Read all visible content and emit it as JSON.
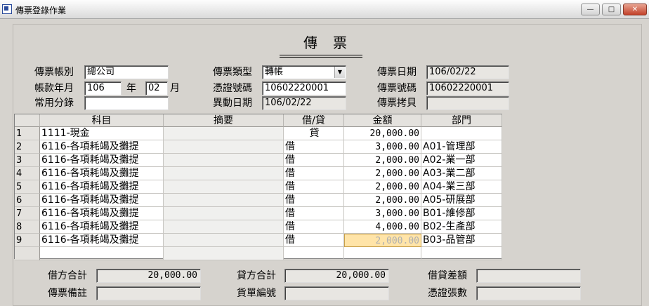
{
  "window": {
    "title": "傳票登錄作業",
    "min": "—",
    "max": "□",
    "close": "✕"
  },
  "header": {
    "title": "傳票",
    "account_label": "傳票帳別",
    "account_value": "總公司",
    "period_label": "帳款年月",
    "year_value": "106",
    "year_unit": "年",
    "month_value": "02",
    "month_unit": "月",
    "common_label": "常用分錄",
    "common_value": "",
    "type_label": "傳票類型",
    "type_value": "轉帳",
    "voucher_no_label": "憑證號碼",
    "voucher_no_value": "10602220001",
    "change_date_label": "異動日期",
    "change_date_value": "106/02/22",
    "date_label": "傳票日期",
    "date_value": "106/02/22",
    "number_label": "傳票號碼",
    "number_value": "10602220001",
    "copy_label": "傳票拷貝",
    "copy_value": ""
  },
  "table": {
    "columns": [
      "科目",
      "摘要",
      "借/貸",
      "金額",
      "部門"
    ],
    "rows": [
      {
        "n": "1",
        "subject": "1111-現金",
        "memo": "",
        "dc": "貸",
        "amount": "20,000.00",
        "dept": ""
      },
      {
        "n": "2",
        "subject": "6116-各項耗竭及攤提",
        "memo": "",
        "dc": "借",
        "amount": "3,000.00",
        "dept": "A01-管理部"
      },
      {
        "n": "3",
        "subject": "6116-各項耗竭及攤提",
        "memo": "",
        "dc": "借",
        "amount": "2,000.00",
        "dept": "A02-業一部"
      },
      {
        "n": "4",
        "subject": "6116-各項耗竭及攤提",
        "memo": "",
        "dc": "借",
        "amount": "2,000.00",
        "dept": "A03-業二部"
      },
      {
        "n": "5",
        "subject": "6116-各項耗竭及攤提",
        "memo": "",
        "dc": "借",
        "amount": "2,000.00",
        "dept": "A04-業三部"
      },
      {
        "n": "6",
        "subject": "6116-各項耗竭及攤提",
        "memo": "",
        "dc": "借",
        "amount": "2,000.00",
        "dept": "A05-研展部"
      },
      {
        "n": "7",
        "subject": "6116-各項耗竭及攤提",
        "memo": "",
        "dc": "借",
        "amount": "3,000.00",
        "dept": "B01-維修部"
      },
      {
        "n": "8",
        "subject": "6116-各項耗竭及攤提",
        "memo": "",
        "dc": "借",
        "amount": "4,000.00",
        "dept": "B02-生產部"
      },
      {
        "n": "9",
        "subject": "6116-各項耗竭及攤提",
        "memo": "",
        "dc": "借",
        "amount": "2,000.00",
        "dept": "B03-品管部"
      },
      {
        "n": "",
        "subject": "",
        "memo": "",
        "dc": "",
        "amount": "",
        "dept": ""
      }
    ]
  },
  "footer": {
    "debit_total_label": "借方合計",
    "debit_total_value": "20,000.00",
    "credit_total_label": "貸方合計",
    "credit_total_value": "20,000.00",
    "diff_label": "借貸差額",
    "diff_value": "",
    "remark_label": "傳票備註",
    "remark_value": "",
    "bill_no_label": "貨單編號",
    "bill_no_value": "",
    "voucher_count_label": "憑證張數",
    "voucher_count_value": ""
  },
  "colors": {
    "form_bg": "#d6d3ce",
    "selected_cell": "#ffe4a8"
  }
}
